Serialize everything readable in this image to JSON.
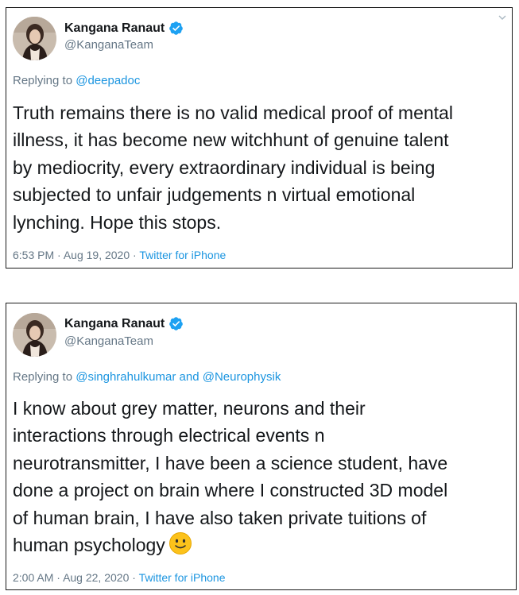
{
  "tweets": [
    {
      "author": {
        "display_name": "Kangana Ranaut",
        "handle": "@KanganaTeam",
        "verified": true,
        "avatar_icon": "profile-photo"
      },
      "replying_prefix": "Replying to",
      "replying_to": [
        "@deepadoc"
      ],
      "text_lines": [
        "Truth remains there is no valid medical proof of mental",
        "illness, it has become new witchhunt of genuine talent",
        "by mediocrity, every extraordinary individual is being",
        "subjected to unfair judgements n virtual emotional",
        "lynching. Hope this stops."
      ],
      "time": "6:53 PM",
      "date": "Aug 19, 2020",
      "source": "Twitter for iPhone"
    },
    {
      "author": {
        "display_name": "Kangana Ranaut",
        "handle": "@KanganaTeam",
        "verified": true,
        "avatar_icon": "profile-photo"
      },
      "replying_prefix": "Replying to",
      "replying_to": [
        "@singhrahulkumar",
        "@Neurophysik"
      ],
      "replying_joiner": "and",
      "text_lines": [
        "I know about grey matter, neurons and their",
        "interactions through electrical events n",
        "neurotransmitter, I have been a science student, have",
        "done a project on brain where I constructed 3D model",
        "of human brain, I have also taken private tuitions of",
        "human psychology"
      ],
      "emoji": "slightly-smiling-face",
      "time": "2:00 AM",
      "date": "Aug 22, 2020",
      "source": "Twitter for iPhone"
    }
  ],
  "separator": "·",
  "colors": {
    "link": "#1b95e0",
    "secondary_text": "#657786",
    "primary_text": "#14171a",
    "verified_badge": "#1da1f2",
    "frame_border": "#1a1a1a"
  }
}
